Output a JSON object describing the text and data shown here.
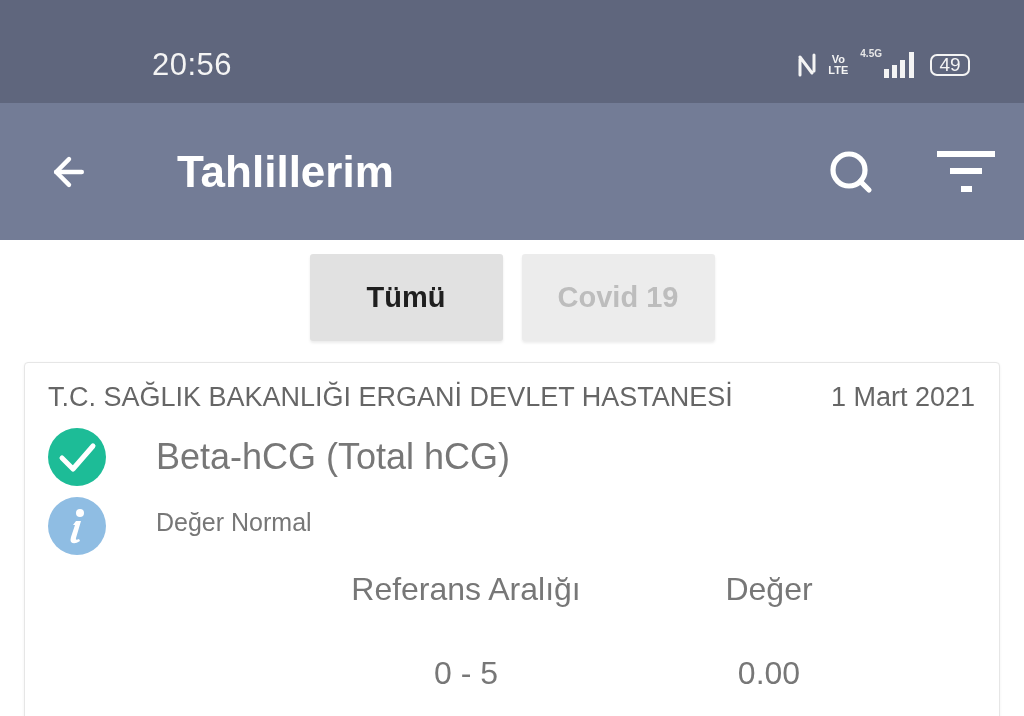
{
  "status_bar": {
    "time": "20:56",
    "volte": {
      "top": "Vo",
      "bottom": "LTE"
    },
    "network": "4.5G",
    "battery": "49"
  },
  "app_bar": {
    "title": "Tahlillerim"
  },
  "tabs": [
    {
      "label": "Tümü",
      "selected": true
    },
    {
      "label": "Covid 19",
      "selected": false
    }
  ],
  "results": [
    {
      "hospital": "T.C. SAĞLIK BAKANLIĞI ERGANİ DEVLET HASTANESİ",
      "date": "1 Mart 2021",
      "test": "Beta-hCG (Total hCG)",
      "normal": true,
      "note": "Değer Normal",
      "columns": [
        "Referans Aralığı",
        "Değer"
      ],
      "values": [
        "0 - 5",
        "0.00"
      ]
    }
  ]
}
